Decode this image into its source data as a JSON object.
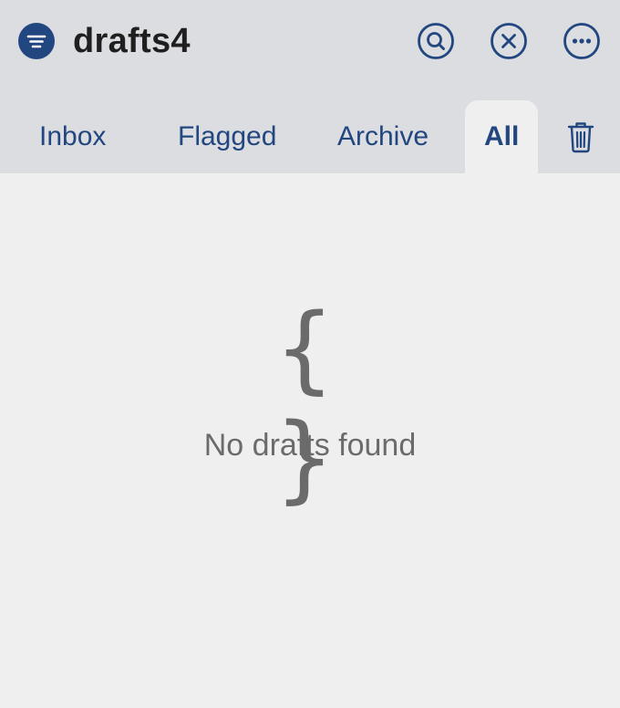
{
  "header": {
    "title": "drafts4",
    "icons": {
      "filter": "filter-icon",
      "search": "search-icon",
      "close": "close-icon",
      "more": "more-icon"
    }
  },
  "tabs": [
    {
      "label": "Inbox",
      "active": false
    },
    {
      "label": "Flagged",
      "active": false
    },
    {
      "label": "Archive",
      "active": false
    },
    {
      "label": "All",
      "active": true
    }
  ],
  "trash_icon": "trash-icon",
  "empty_state": {
    "icon": "{ }",
    "message": "No drafts found"
  },
  "colors": {
    "accent": "#22467f",
    "header_bg": "#dcdde0",
    "body_bg": "#efefef",
    "muted_text": "#6b6b6b"
  }
}
